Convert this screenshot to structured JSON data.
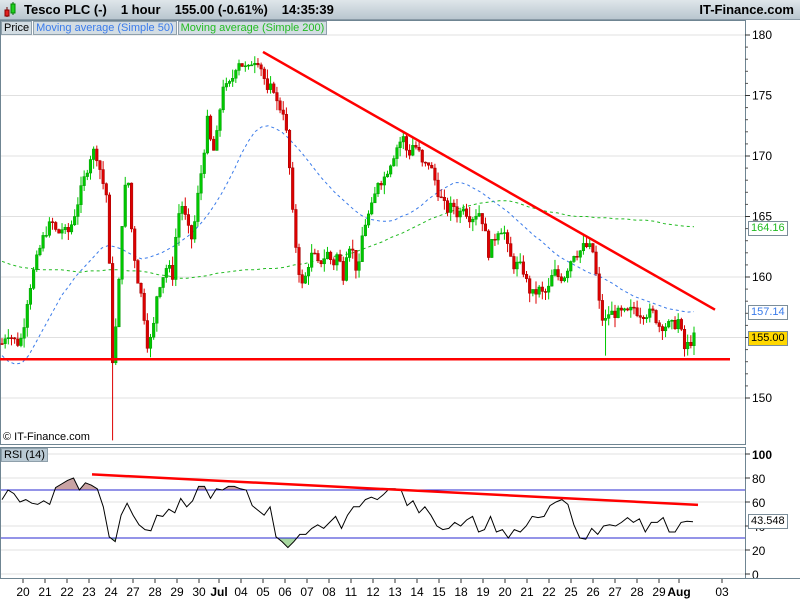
{
  "header": {
    "symbol": "Tesco PLC (-)",
    "timeframe": "1 hour",
    "price_change": "155.00 (-0.61%)",
    "time": "14:35:39",
    "brand": "IT-Finance.com"
  },
  "legend": {
    "price": "Price",
    "ma50": "Moving average (Simple 50)",
    "ma200": "Moving average (Simple 200)"
  },
  "rsi_label": "RSI (14)",
  "copyright": "© IT-Finance.com",
  "tags": {
    "ma200": "164.16",
    "ma50": "157.14",
    "last": "155.00",
    "rsi": "43.548"
  },
  "colors": {
    "up": "#00c800",
    "down": "#dd0000",
    "ma50": "#3a7bea",
    "ma200": "#22bb22",
    "trend": "#ff0000",
    "rsi_band": "#2a2ad0",
    "last_tag": "#ffd800"
  },
  "chart_data": [
    {
      "type": "candlestick",
      "title": "Tesco PLC (-) 1 hour",
      "ylim": [
        146,
        181
      ],
      "y_ticks": [
        150,
        155,
        160,
        165,
        170,
        175,
        180
      ],
      "x_ticks": [
        "20",
        "21",
        "22",
        "23",
        "24",
        "27",
        "28",
        "29",
        "30",
        "Jul",
        "04",
        "05",
        "06",
        "07",
        "08",
        "11",
        "12",
        "13",
        "14",
        "15",
        "18",
        "19",
        "20",
        "21",
        "22",
        "25",
        "26",
        "27",
        "28",
        "29",
        "Aug",
        "03"
      ],
      "close_samples": [
        154.5,
        155.5,
        155,
        154.5,
        155,
        158,
        160,
        161.5,
        163,
        164,
        164.5,
        163.5,
        164,
        163.5,
        164.5,
        166,
        167.5,
        169,
        170.5,
        170,
        168,
        166.5,
        153,
        157,
        165,
        169,
        163,
        160,
        158,
        154.5,
        155,
        159,
        160,
        161,
        160,
        165,
        166,
        164,
        163,
        166.5,
        169.5,
        173,
        170,
        172,
        176,
        175.5,
        176.5,
        178,
        177.5,
        177,
        178,
        178,
        177,
        175,
        176,
        174,
        174,
        171,
        165,
        161,
        159,
        161,
        162,
        161,
        161.5,
        162,
        161,
        162,
        160,
        163,
        162,
        160,
        164,
        165,
        166,
        168,
        168,
        169,
        170,
        171,
        171.5,
        170,
        171,
        170.5,
        169,
        169.5,
        168.5,
        167,
        166,
        165.5,
        166,
        165,
        166,
        165,
        165,
        165.5,
        164.5,
        162,
        163,
        164,
        164,
        162,
        161,
        161,
        160.5,
        159,
        158.5,
        159,
        158.5,
        159,
        160.5,
        160,
        160,
        161,
        162,
        162,
        162.5,
        162.5,
        162,
        158,
        156,
        157,
        157,
        157,
        157,
        157,
        157.5,
        157,
        157,
        157,
        157,
        156,
        156,
        156,
        156,
        156.5,
        154,
        154.5,
        155
      ],
      "extreme_wicks": [
        {
          "sample": 22,
          "low": 146.5
        },
        {
          "sample": 120,
          "low": 153.5
        }
      ],
      "ma50_samples": [
        153.5,
        153,
        152.8,
        152.9,
        153.5,
        154.5,
        155.5,
        156.5,
        157.5,
        158.5,
        159.2,
        160,
        160.6,
        161.2,
        161.8,
        162.4,
        162.6,
        162.5,
        162.3,
        162,
        161.7,
        161.5,
        161.6,
        161.8,
        162,
        162.3,
        162.6,
        163,
        163.4,
        163.9,
        164.5,
        165.2,
        166,
        166.9,
        167.9,
        169,
        170.2,
        171.2,
        172,
        172.4,
        172.5,
        172.3,
        172,
        171.5,
        170.9,
        170.3,
        169.6,
        168.9,
        168.2,
        167.6,
        167,
        166.5,
        166,
        165.5,
        165.1,
        164.8,
        164.7,
        164.6,
        164.6,
        164.7,
        165,
        165.2,
        165.5,
        165.9,
        166.4,
        166.8,
        167.2,
        167.5,
        167.8,
        167.8,
        167.6,
        167.3,
        167,
        166.6,
        166.2,
        165.8,
        165.4,
        164.9,
        164.4,
        163.9,
        163.4,
        163,
        162.5,
        162,
        161.6,
        161.3,
        161,
        160.7,
        160.4,
        160.2,
        160,
        159.7,
        159.4,
        159,
        158.7,
        158.4,
        158.2,
        158,
        157.8,
        157.6,
        157.4,
        157.3,
        157.2,
        157.1,
        157.14
      ],
      "ma200_samples": [
        161.3,
        161,
        160.8,
        160.7,
        160.6,
        160.6,
        160.6,
        160.5,
        160.4,
        160.5,
        160.5,
        160.6,
        160.6,
        160.5,
        160.5,
        160.4,
        160.2,
        160.1,
        159.9,
        159.9,
        160,
        160.1,
        160.3,
        160.4,
        160.5,
        160.6,
        160.6,
        160.7,
        160.7,
        160.8,
        161,
        161.1,
        161.3,
        161.5,
        161.7,
        161.8,
        162,
        162.3,
        162.6,
        162.9,
        163.3,
        163.6,
        164,
        164.4,
        164.8,
        165.1,
        165.4,
        165.7,
        165.9,
        166.1,
        166.2,
        166.3,
        166.3,
        166.1,
        165.8,
        165.6,
        165.4,
        165.3,
        165.1,
        165,
        165,
        164.9,
        164.9,
        164.8,
        164.8,
        164.7,
        164.7,
        164.6,
        164.4,
        164.3,
        164.2,
        164.16
      ],
      "trendlines": [
        {
          "name": "resistance",
          "from": 178.6,
          "to": 157.3
        },
        {
          "name": "support",
          "value": 153.2
        }
      ]
    },
    {
      "type": "line",
      "title": "RSI (14)",
      "ylim": [
        0,
        100
      ],
      "y_ticks": [
        0,
        20,
        40,
        60,
        80,
        100
      ],
      "bands": [
        30,
        70
      ],
      "samples": [
        62,
        70,
        67,
        60,
        62,
        59,
        58,
        61,
        58,
        72,
        75,
        78,
        80,
        70,
        76,
        74,
        71,
        56,
        31,
        27,
        49,
        59,
        49,
        41,
        37,
        36,
        49,
        48,
        54,
        51,
        63,
        56,
        61,
        73,
        73,
        63,
        71,
        70,
        73,
        73,
        71,
        70,
        57,
        53,
        49,
        56,
        31,
        27,
        22,
        27,
        33,
        33,
        38,
        41,
        38,
        43,
        48,
        38,
        49,
        56,
        56,
        62,
        64,
        62,
        66,
        71,
        71,
        70,
        57,
        61,
        51,
        56,
        49,
        40,
        37,
        38,
        43,
        40,
        45,
        48,
        35,
        37,
        48,
        35,
        37,
        30,
        37,
        35,
        40,
        48,
        47,
        48,
        57,
        60,
        62,
        58,
        41,
        30,
        29,
        38,
        33,
        40,
        41,
        40,
        43,
        47,
        43,
        46,
        35,
        43,
        43,
        47,
        35,
        35,
        43,
        44,
        43.548
      ],
      "trendline": {
        "from": 83,
        "to": 57.6
      }
    }
  ]
}
